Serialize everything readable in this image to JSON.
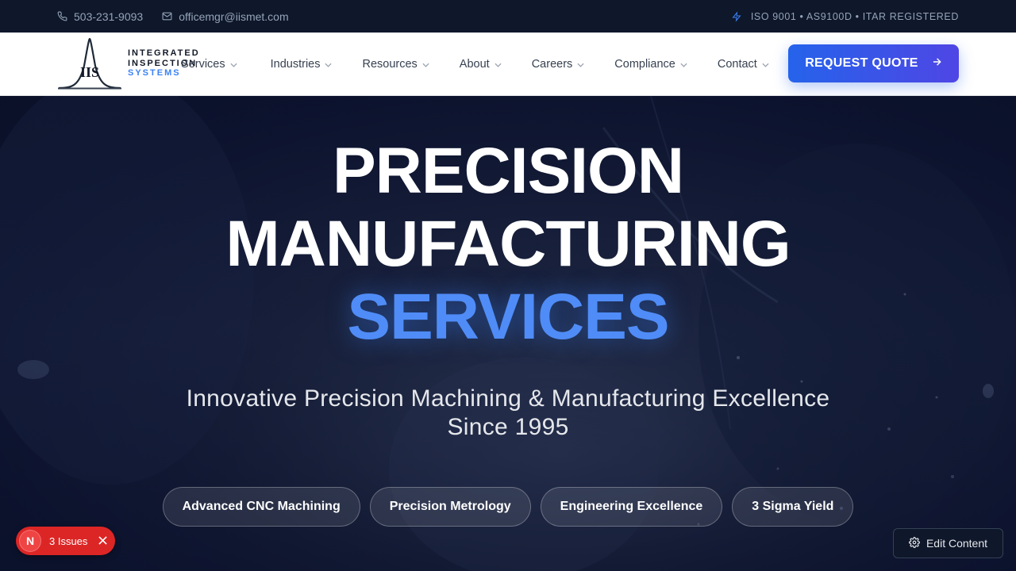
{
  "topbar": {
    "phone": "503-231-9093",
    "email": "officemgr@iismet.com",
    "certifications": "ISO 9001 • AS9100D • ITAR REGISTERED"
  },
  "logo": {
    "mark": "IIS",
    "line1": "INTEGRATED",
    "line2": "INSPECTION",
    "line3": "SYSTEMS"
  },
  "nav": {
    "items": [
      {
        "label": "Services"
      },
      {
        "label": "Industries"
      },
      {
        "label": "Resources"
      },
      {
        "label": "About"
      },
      {
        "label": "Careers"
      },
      {
        "label": "Compliance"
      },
      {
        "label": "Contact"
      }
    ],
    "cta_label": "REQUEST QUOTE"
  },
  "hero": {
    "line1": "PRECISION",
    "line2": "MANUFACTURING",
    "line3": "SERVICES",
    "subtitle": "Innovative Precision Machining & Manufacturing Excellence Since 1995",
    "pills": [
      {
        "label": "Advanced CNC Machining"
      },
      {
        "label": "Precision Metrology"
      },
      {
        "label": "Engineering Excellence"
      },
      {
        "label": "3 Sigma Yield"
      }
    ]
  },
  "overlays": {
    "issues_badge_letter": "N",
    "issues_label": "3 Issues",
    "edit_label": "Edit Content"
  },
  "colors": {
    "accent": "#3b82f6",
    "cta_start": "#2563eb",
    "cta_end": "#4f46e5",
    "issues": "#dc2626"
  }
}
